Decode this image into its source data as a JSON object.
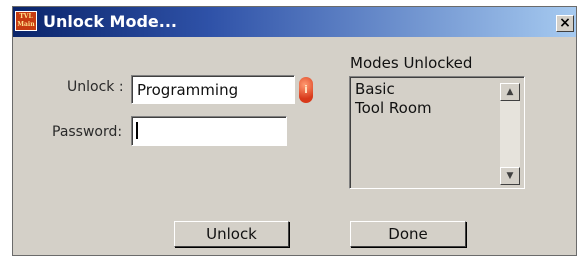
{
  "window": {
    "title": "Unlock Mode...",
    "app_icon_text": "TVL Main",
    "close_label": "×"
  },
  "form": {
    "unlock_label": "Unlock :",
    "unlock_value": "Programming",
    "password_label": "Password:",
    "password_value": ""
  },
  "modes": {
    "heading": "Modes Unlocked",
    "items": [
      "Basic",
      "Tool Room"
    ]
  },
  "buttons": {
    "unlock": "Unlock",
    "done": "Done"
  },
  "icons": {
    "app": "app-logo-icon",
    "info": "info-icon",
    "scroll_up": "scroll-up-arrow-icon",
    "scroll_down": "scroll-down-arrow-icon"
  },
  "colors": {
    "title_bar_start": "#0a246a",
    "title_bar_end": "#a6caf0",
    "dialog_face": "#d4d0c8",
    "info_icon": "#d8391a"
  }
}
